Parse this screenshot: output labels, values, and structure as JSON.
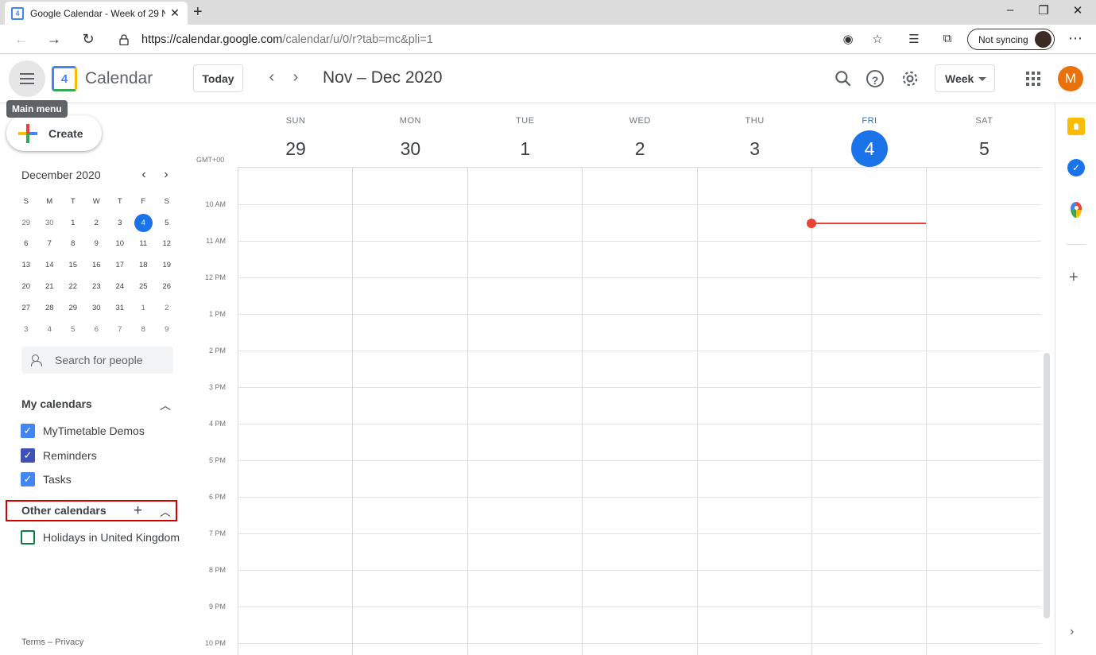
{
  "browser": {
    "tab_title": "Google Calendar - Week of 29 N",
    "tab_favicon": "4",
    "url_host": "https://calendar.google.com",
    "url_path": "/calendar/u/0/r?tab=mc&pli=1",
    "sync_label": "Not syncing"
  },
  "header": {
    "app_name": "Calendar",
    "logo_text": "4",
    "today_label": "Today",
    "range_title": "Nov – Dec 2020",
    "view_label": "Week",
    "avatar_initial": "M",
    "tooltip": "Main menu"
  },
  "sidebar": {
    "create_label": "Create",
    "mini_calendar": {
      "title": "December 2020",
      "dow": [
        "S",
        "M",
        "T",
        "W",
        "T",
        "F",
        "S"
      ],
      "weeks": [
        [
          "29",
          "30",
          "1",
          "2",
          "3",
          "4",
          "5"
        ],
        [
          "6",
          "7",
          "8",
          "9",
          "10",
          "11",
          "12"
        ],
        [
          "13",
          "14",
          "15",
          "16",
          "17",
          "18",
          "19"
        ],
        [
          "20",
          "21",
          "22",
          "23",
          "24",
          "25",
          "26"
        ],
        [
          "27",
          "28",
          "29",
          "30",
          "31",
          "1",
          "2"
        ],
        [
          "3",
          "4",
          "5",
          "6",
          "7",
          "8",
          "9"
        ]
      ]
    },
    "people_placeholder": "Search for people",
    "my_calendars_title": "My calendars",
    "my_calendars": [
      {
        "label": "MyTimetable Demos",
        "color": "#4285f4",
        "checked": true
      },
      {
        "label": "Reminders",
        "color": "#3f51b5",
        "checked": true
      },
      {
        "label": "Tasks",
        "color": "#4285f4",
        "checked": true
      }
    ],
    "other_calendars_title": "Other calendars",
    "other_calendars": [
      {
        "label": "Holidays in United Kingdom",
        "color": "#0b8043",
        "checked": false
      }
    ],
    "footer": "Terms – Privacy"
  },
  "week": {
    "timezone": "GMT+00",
    "days": [
      {
        "dow": "SUN",
        "num": "29"
      },
      {
        "dow": "MON",
        "num": "30"
      },
      {
        "dow": "TUE",
        "num": "1"
      },
      {
        "dow": "WED",
        "num": "2"
      },
      {
        "dow": "THU",
        "num": "3"
      },
      {
        "dow": "FRI",
        "num": "4",
        "today": true
      },
      {
        "dow": "SAT",
        "num": "5"
      }
    ],
    "hours": [
      "10 AM",
      "11 AM",
      "12 PM",
      "1 PM",
      "2 PM",
      "3 PM",
      "4 PM",
      "5 PM",
      "6 PM",
      "7 PM",
      "8 PM",
      "9 PM",
      "10 PM"
    ]
  },
  "colors": {
    "accent": "#1a73e8",
    "now_line": "#ea4335",
    "highlight": "#d50000"
  },
  "icons": {
    "menu": "hamburger-icon",
    "search": "search-icon",
    "help": "help-icon",
    "settings": "gear-icon",
    "apps": "apps-grid-icon",
    "keep": "keep-icon",
    "tasks": "tasks-icon",
    "maps": "maps-icon"
  }
}
